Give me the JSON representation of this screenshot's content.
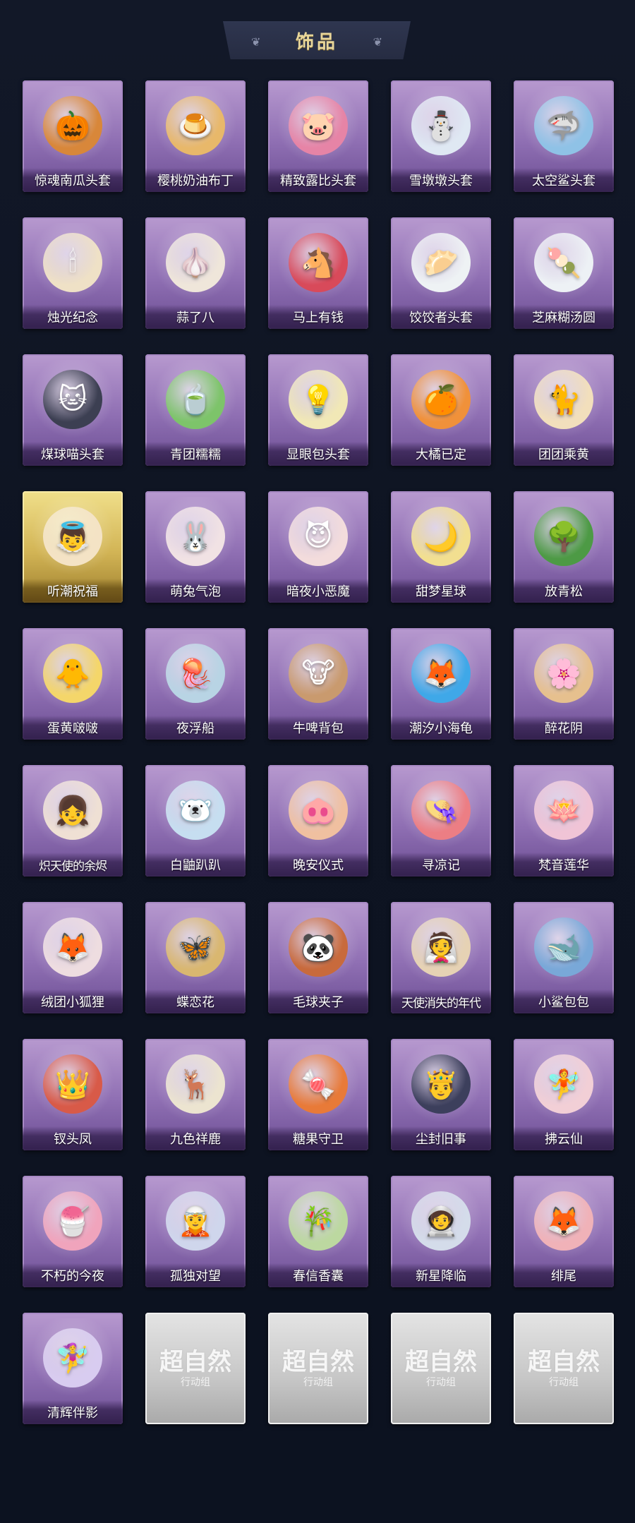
{
  "header": {
    "title": "饰品"
  },
  "colors": {
    "accent_gold": "#e8d69a",
    "card_purple": "#8f6fb3",
    "card_gold": "#d2b455",
    "card_locked": "#c6c6c6",
    "background": "#0e1320"
  },
  "items": [
    {
      "name": "惊魂南瓜头套",
      "icon": "pumpkin-icon",
      "glyph": "🎃",
      "bg": "#d8873a",
      "variant": "normal"
    },
    {
      "name": "樱桃奶油布丁",
      "icon": "pudding-icon",
      "glyph": "🍮",
      "bg": "#e8b86a",
      "variant": "normal"
    },
    {
      "name": "精致露比头套",
      "icon": "pink-pig-icon",
      "glyph": "🐷",
      "bg": "#e684a6",
      "variant": "normal"
    },
    {
      "name": "雪墩墩头套",
      "icon": "snowman-icon",
      "glyph": "⛄",
      "bg": "#dfe8f3",
      "variant": "normal"
    },
    {
      "name": "太空鲨头套",
      "icon": "shark-icon",
      "glyph": "🦈",
      "bg": "#8fc2e6",
      "variant": "normal"
    },
    {
      "name": "烛光纪念",
      "icon": "candle-icon",
      "glyph": "🕯",
      "bg": "#efe1c6",
      "variant": "normal"
    },
    {
      "name": "蒜了八",
      "icon": "garlic-icon",
      "glyph": "🧄",
      "bg": "#efe6da",
      "variant": "normal"
    },
    {
      "name": "马上有钱",
      "icon": "horse-icon",
      "glyph": "🐴",
      "bg": "#d84a5a",
      "variant": "normal"
    },
    {
      "name": "饺饺者头套",
      "icon": "dumpling-icon",
      "glyph": "🥟",
      "bg": "#eef2f4",
      "variant": "normal"
    },
    {
      "name": "芝麻糊汤圆",
      "icon": "tangyuan-icon",
      "glyph": "🍡",
      "bg": "#edf1f5",
      "variant": "normal"
    },
    {
      "name": "煤球喵头套",
      "icon": "black-cat-icon",
      "glyph": "🐱",
      "bg": "#3c3f52",
      "variant": "normal"
    },
    {
      "name": "青团糯糯",
      "icon": "green-rice-ball-icon",
      "glyph": "🍵",
      "bg": "#7dc46a",
      "variant": "normal"
    },
    {
      "name": "显眼包头套",
      "icon": "lightbulb-icon",
      "glyph": "💡",
      "bg": "#f1e8b6",
      "variant": "normal"
    },
    {
      "name": "大橘已定",
      "icon": "orange-slice-icon",
      "glyph": "🍊",
      "bg": "#f0913a",
      "variant": "normal"
    },
    {
      "name": "团团乘黄",
      "icon": "cream-cat-icon",
      "glyph": "🐈",
      "bg": "#f2dfbc",
      "variant": "normal"
    },
    {
      "name": "听潮祝福",
      "icon": "angel-figure-icon",
      "glyph": "👼",
      "bg": "#f4e3c5",
      "variant": "gold"
    },
    {
      "name": "萌兔气泡",
      "icon": "bunny-bubble-icon",
      "glyph": "🐰",
      "bg": "#f1e2e4",
      "variant": "normal"
    },
    {
      "name": "暗夜小恶魔",
      "icon": "devil-icon",
      "glyph": "😈",
      "bg": "#f3dcdc",
      "variant": "normal"
    },
    {
      "name": "甜梦星球",
      "icon": "moon-icon",
      "glyph": "🌙",
      "bg": "#f2df90",
      "variant": "normal"
    },
    {
      "name": "放青松",
      "icon": "bonsai-icon",
      "glyph": "🌳",
      "bg": "#4d9a45",
      "variant": "normal"
    },
    {
      "name": "蛋黄啵啵",
      "icon": "chick-icon",
      "glyph": "🐥",
      "bg": "#f4d66a",
      "variant": "normal"
    },
    {
      "name": "夜浮船",
      "icon": "jellyfish-icon",
      "glyph": "🪼",
      "bg": "#b8d4e4",
      "variant": "normal"
    },
    {
      "name": "牛啤背包",
      "icon": "cow-beer-icon",
      "glyph": "🐮",
      "bg": "#c99a6e",
      "variant": "normal"
    },
    {
      "name": "潮汐小海龟",
      "icon": "blue-fox-icon",
      "glyph": "🦊",
      "bg": "#3fa8e8",
      "variant": "normal"
    },
    {
      "name": "醉花阴",
      "icon": "flower-ornament-icon",
      "glyph": "🌸",
      "bg": "#e6c08e",
      "variant": "normal"
    },
    {
      "name": "炽天使的余烬",
      "icon": "angel-girl-icon",
      "glyph": "👧",
      "bg": "#efe0d4",
      "variant": "normal",
      "long": true
    },
    {
      "name": "白鼬趴趴",
      "icon": "ermine-icon",
      "glyph": "🐻‍❄️",
      "bg": "#c6def0",
      "variant": "normal"
    },
    {
      "name": "晚安仪式",
      "icon": "pig-pajama-icon",
      "glyph": "🐽",
      "bg": "#f0c0a0",
      "variant": "normal"
    },
    {
      "name": "寻凉记",
      "icon": "sunhat-icon",
      "glyph": "👒",
      "bg": "#ec7e84",
      "variant": "normal"
    },
    {
      "name": "梵音莲华",
      "icon": "lotus-girl-icon",
      "glyph": "🪷",
      "bg": "#f0c4d6",
      "variant": "normal"
    },
    {
      "name": "绒团小狐狸",
      "icon": "fox-doll-icon",
      "glyph": "🦊",
      "bg": "#eedde0",
      "variant": "normal"
    },
    {
      "name": "蝶恋花",
      "icon": "butterfly-ornament-icon",
      "glyph": "🦋",
      "bg": "#d9b770",
      "variant": "normal"
    },
    {
      "name": "毛球夹子",
      "icon": "red-panda-icon",
      "glyph": "🐼",
      "bg": "#c86a3c",
      "variant": "normal"
    },
    {
      "name": "天使消失的年代",
      "icon": "veiled-girl-icon",
      "glyph": "👰",
      "bg": "#e6d2b4",
      "variant": "normal",
      "long": true
    },
    {
      "name": "小鲨包包",
      "icon": "shark-bag-icon",
      "glyph": "🐋",
      "bg": "#79a8d8",
      "variant": "normal"
    },
    {
      "name": "钗头凤",
      "icon": "phoenix-crown-icon",
      "glyph": "👑",
      "bg": "#d85a48",
      "variant": "normal"
    },
    {
      "name": "九色祥鹿",
      "icon": "deer-icon",
      "glyph": "🦌",
      "bg": "#ece4d0",
      "variant": "normal"
    },
    {
      "name": "糖果守卫",
      "icon": "candy-guard-icon",
      "glyph": "🍬",
      "bg": "#e87a38",
      "variant": "normal"
    },
    {
      "name": "尘封旧事",
      "icon": "dark-prince-icon",
      "glyph": "🤴",
      "bg": "#3c3f5c",
      "variant": "normal"
    },
    {
      "name": "拂云仙",
      "icon": "cloud-fairy-icon",
      "glyph": "🧚",
      "bg": "#f2cfd6",
      "variant": "normal"
    },
    {
      "name": "不朽的今夜",
      "icon": "cat-cup-icon",
      "glyph": "🍧",
      "bg": "#f0a4bc",
      "variant": "normal"
    },
    {
      "name": "孤独对望",
      "icon": "white-hair-figure-icon",
      "glyph": "🧝",
      "bg": "#cfd6ec",
      "variant": "normal"
    },
    {
      "name": "春信香囊",
      "icon": "sachet-icon",
      "glyph": "🎋",
      "bg": "#bcd8a0",
      "variant": "normal"
    },
    {
      "name": "新星降临",
      "icon": "star-boy-icon",
      "glyph": "🧑‍🚀",
      "bg": "#d4dcea",
      "variant": "normal"
    },
    {
      "name": "绯尾",
      "icon": "pink-fox-icon",
      "glyph": "🦊",
      "bg": "#f0b2b8",
      "variant": "normal"
    },
    {
      "name": "清辉伴影",
      "icon": "lilac-fairy-icon",
      "glyph": "🧚‍♀️",
      "bg": "#d8ccf0",
      "variant": "normal"
    },
    {
      "name": "",
      "icon": "locked-placeholder-icon",
      "glyph": "",
      "bg": "",
      "variant": "locked"
    },
    {
      "name": "",
      "icon": "locked-placeholder-icon",
      "glyph": "",
      "bg": "",
      "variant": "locked"
    },
    {
      "name": "",
      "icon": "locked-placeholder-icon",
      "glyph": "",
      "bg": "",
      "variant": "locked"
    },
    {
      "name": "",
      "icon": "locked-placeholder-icon",
      "glyph": "",
      "bg": "",
      "variant": "locked"
    }
  ],
  "locked": {
    "logo_text": "超自然",
    "sub_text": "行动组"
  }
}
